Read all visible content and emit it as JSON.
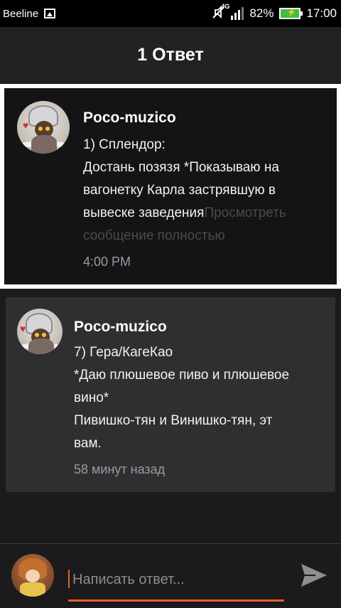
{
  "statusbar": {
    "carrier": "Beeline",
    "network": "4G",
    "battery": "82%",
    "time": "17:00"
  },
  "header": {
    "title": "1 Ответ"
  },
  "replies": [
    {
      "author": "Poco-muzico",
      "lines": [
        "1) Сплендор:",
        "Достань позязя *Показываю на",
        "вагонетку Карла застрявшую в",
        "вывеске заведения"
      ],
      "more": "Просмотреть",
      "more_cont": "сообщение полностью",
      "time": "4:00 PM"
    },
    {
      "author": "Poco-muzico",
      "lines": [
        "7) Гера/КагеКао",
        "*Даю плюшевое пиво и плюшевое",
        "вино*",
        "Пивишко-тян и Винишко-тян, эт",
        "вам."
      ],
      "time": "58 минут назад"
    }
  ],
  "composer": {
    "placeholder": "Написать ответ...",
    "value": ""
  },
  "colors": {
    "accent": "#e2622a",
    "background": "#1b1a1d",
    "highlight_card": "#141316",
    "card": "#2f2e31"
  },
  "icons": [
    "gallery-icon",
    "mute-icon",
    "signal-icon",
    "battery-icon",
    "send-icon"
  ]
}
